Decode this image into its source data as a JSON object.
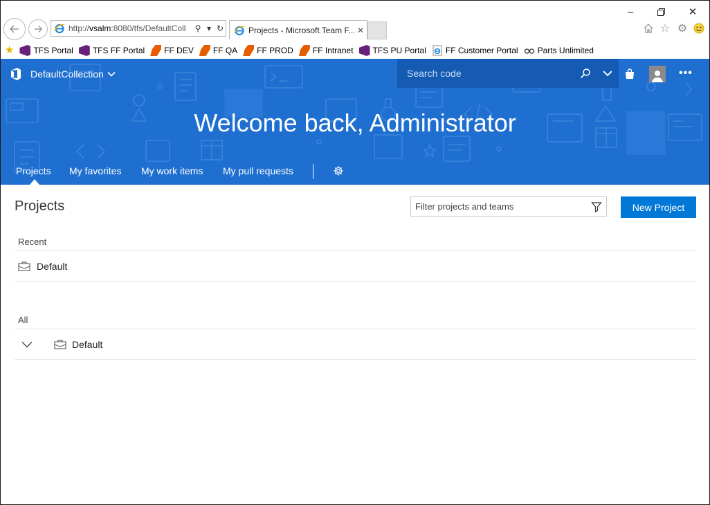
{
  "browser": {
    "address_url_prefix": "http://",
    "address_url_host": "vsalm",
    "address_url_rest": ":8080/tfs/DefaultColl",
    "tab_title": "Projects - Microsoft Team F...",
    "favorites": [
      {
        "label": "TFS Portal",
        "icon": "visual-studio-icon"
      },
      {
        "label": "TFS FF Portal",
        "icon": "visual-studio-icon"
      },
      {
        "label": "FF DEV",
        "icon": "fabrikam-icon"
      },
      {
        "label": "FF QA",
        "icon": "fabrikam-icon"
      },
      {
        "label": "FF PROD",
        "icon": "fabrikam-icon"
      },
      {
        "label": "FF Intranet",
        "icon": "fabrikam-icon"
      },
      {
        "label": "TFS PU Portal",
        "icon": "visual-studio-icon"
      },
      {
        "label": "FF Customer Portal",
        "icon": "ie-page-icon"
      },
      {
        "label": "Parts Unlimited",
        "icon": "glasses-icon"
      }
    ]
  },
  "header": {
    "collection": "DefaultCollection",
    "search_placeholder": "Search code",
    "welcome": "Welcome back, Administrator",
    "hubs": [
      "Projects",
      "My favorites",
      "My work items",
      "My pull requests"
    ],
    "selected_hub": "Projects"
  },
  "main": {
    "title": "Projects",
    "filter_placeholder": "Filter projects and teams",
    "new_project_label": "New Project",
    "recent_label": "Recent",
    "recent_projects": [
      "Default"
    ],
    "all_label": "All",
    "all_projects": [
      "Default"
    ]
  },
  "colors": {
    "hero_blue": "#1e6fd0",
    "search_bg": "#155ab3",
    "primary_button": "#0078d7"
  }
}
